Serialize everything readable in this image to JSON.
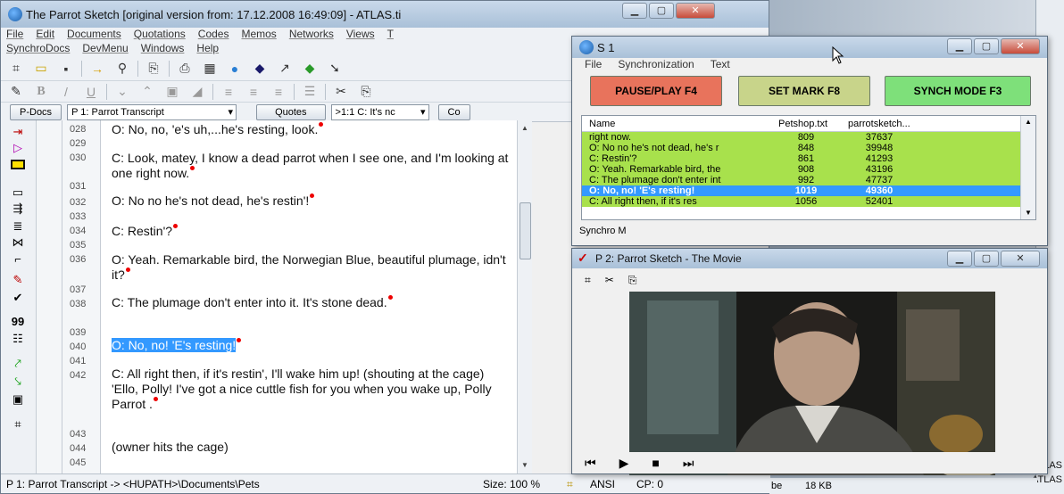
{
  "main_window": {
    "title": "The Parrot Sketch [original version from: 17.12.2008 16:49:09] - ATLAS.ti",
    "menu_row1": [
      "File",
      "Edit",
      "Documents",
      "Quotations",
      "Codes",
      "Memos",
      "Networks",
      "Views",
      "T"
    ],
    "menu_row2": [
      "SynchroDocs",
      "DevMenu",
      "Windows",
      "Help"
    ],
    "pdocs_button": "P-Docs",
    "pdocs_combo": "P 1: Parrot Transcript",
    "quotes_button": "Quotes",
    "quotes_combo": ">1:1 C: It's nc",
    "codes_button": "Co",
    "line_numbers": [
      "028",
      "029",
      "030",
      "031",
      "032",
      "033",
      "034",
      "035",
      "036",
      "037",
      "038",
      "039",
      "040",
      "041",
      "042",
      "043",
      "044",
      "045"
    ],
    "paragraphs": [
      "O: No, no, 'e's uh,...he's resting, look.",
      "C: Look, matey, I know a dead parrot when I see one, and I'm looking at one right now.",
      "O: No no he's not dead, he's restin'!",
      "C: Restin'?",
      "O: Yeah. Remarkable bird, the Norwegian Blue, beautiful plumage, idn't it?",
      "C: The plumage don't enter into it.  It's stone dead.",
      "O: No, no!  'E's resting!",
      "C: All right then, if it's restin', I'll wake him up! (shouting at the cage) 'Ello, Polly! I've got a nice cuttle fish for you when you wake up, Polly Parrot .",
      "(owner hits the cage)"
    ],
    "status": {
      "doc": "P 1: Parrot Transcript -> <HUPATH>\\Documents\\Pets",
      "size": "Size: 100 %",
      "encoding": "ANSI",
      "cp": "CP: 0"
    }
  },
  "sync_window": {
    "title": "S 1",
    "menu": [
      "File",
      "Synchronization",
      "Text"
    ],
    "buttons": {
      "pause": "PAUSE/PLAY F4",
      "mark": "SET MARK F8",
      "synch": "SYNCH MODE F3"
    },
    "button_colors": {
      "pause": "#e8735c",
      "mark": "#c8d48a",
      "synch": "#7ee07a"
    },
    "columns": [
      "Name",
      "Petshop.txt",
      "parrotsketch..."
    ],
    "rows": [
      {
        "name": "right now.",
        "a": "809",
        "b": "37637"
      },
      {
        "name": "O: No no he's not dead, he's r",
        "a": "848",
        "b": "39948"
      },
      {
        "name": "C: Restin'?",
        "a": "861",
        "b": "41293"
      },
      {
        "name": "O: Yeah. Remarkable bird, the",
        "a": "908",
        "b": "43196"
      },
      {
        "name": "C: The plumage don't enter int",
        "a": "992",
        "b": "47737"
      },
      {
        "name": "O: No, no!  'E's resting!",
        "a": "1019",
        "b": "49360"
      },
      {
        "name": "C: All right then, if it's res",
        "a": "1056",
        "b": "52401"
      }
    ],
    "selected_row": 5,
    "status": "Synchro M"
  },
  "movie_window": {
    "title": "P 2: Parrot Sketch - The Movie",
    "controls": [
      "rewind",
      "play",
      "stop",
      "forward"
    ]
  },
  "right_strip": {
    "text_atlas": "ATLAS",
    "text_atlas2": "ATLAS",
    "size_label": "18 KB",
    "be": "be"
  }
}
